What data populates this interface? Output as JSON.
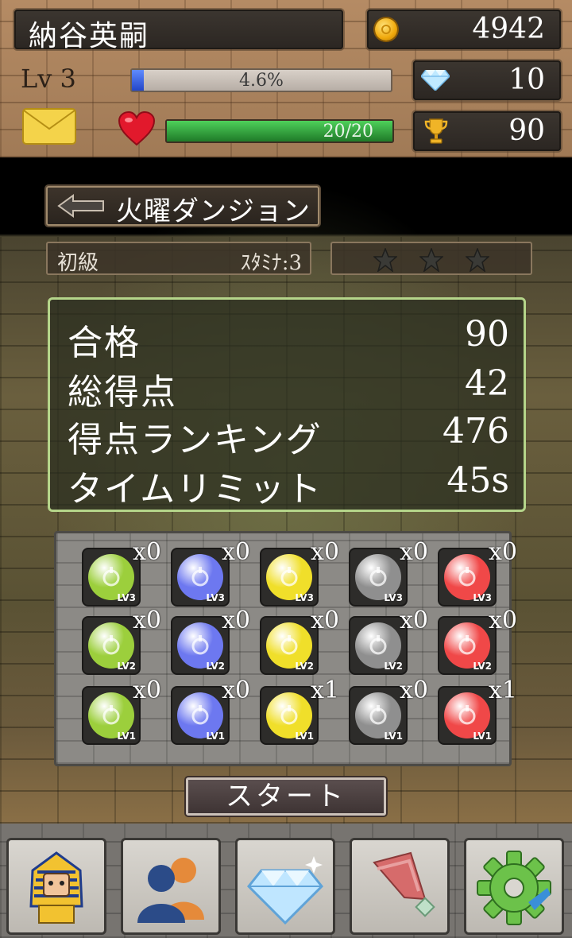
{
  "player": {
    "name": "納谷英嗣",
    "level_text": "Lv 3",
    "xp_text": "4.6%",
    "xp_fraction": 0.046,
    "hp_text": "20/20",
    "hp_fraction": 1.0
  },
  "currency": {
    "gold": "4942",
    "diamonds": "10",
    "trophies": "90"
  },
  "icons": {
    "gold": "coin-icon",
    "diamond": "diamond-icon",
    "trophy": "trophy-icon",
    "mail": "mail-icon",
    "heart": "heart-icon",
    "back": "back-arrow-icon"
  },
  "dungeon": {
    "title": "火曜ダンジョン",
    "difficulty": "初級",
    "stamina": "ｽﾀﾐﾅ:3",
    "stars_earned": 0,
    "stars_total": 3
  },
  "info": {
    "rows": [
      {
        "label": "合格",
        "value": "90"
      },
      {
        "label": "総得点",
        "value": "42"
      },
      {
        "label": "得点ランキング",
        "value": "476"
      },
      {
        "label": "タイムリミット",
        "value": "45s"
      }
    ]
  },
  "items": {
    "colors": [
      "#9ccf3c",
      "#6d78f0",
      "#f0df2a",
      "#8f8f8f",
      "#f04848"
    ],
    "icon_names": [
      "clock-icon",
      "trophy-icon",
      "coin-icon",
      "up-arrow-icon",
      "combo-icon"
    ],
    "rows": [
      {
        "level": "LV3",
        "counts": [
          "x0",
          "x0",
          "x0",
          "x0",
          "x0"
        ]
      },
      {
        "level": "LV2",
        "counts": [
          "x0",
          "x0",
          "x0",
          "x0",
          "x0"
        ]
      },
      {
        "level": "LV1",
        "counts": [
          "x0",
          "x0",
          "x1",
          "x0",
          "x1"
        ]
      }
    ]
  },
  "start_label": "スタート",
  "nav": {
    "items": [
      "pharaoh-icon",
      "friends-icon",
      "gem-shop-icon",
      "flag-icon",
      "settings-gear-icon"
    ]
  }
}
